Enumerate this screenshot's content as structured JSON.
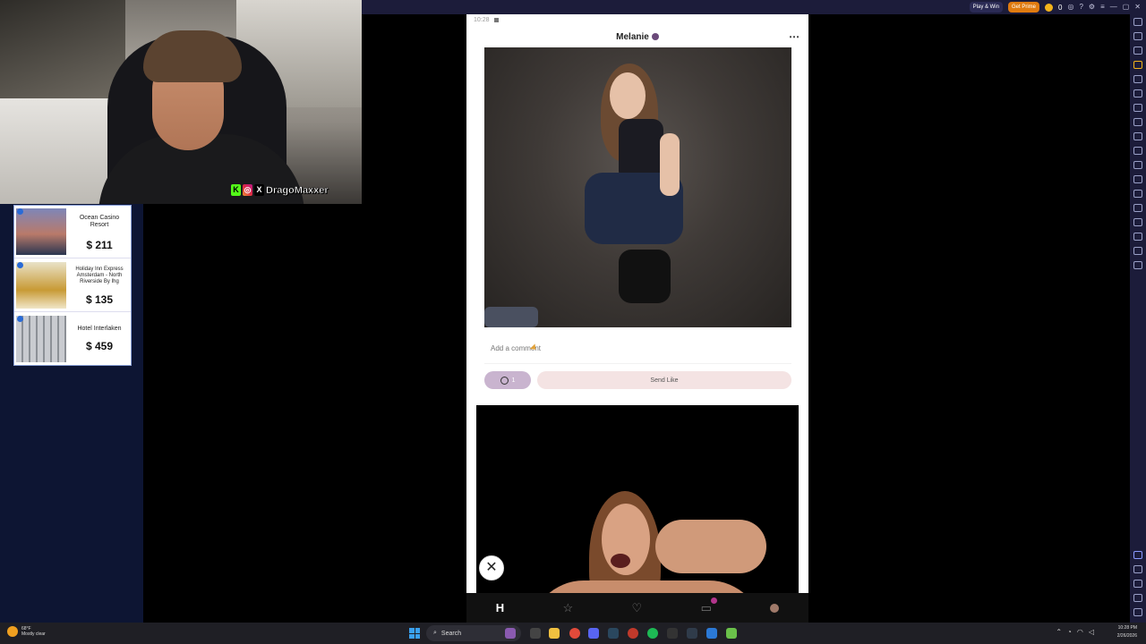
{
  "emulator": {
    "play_win_label": "Play & Win",
    "get_prime_label": "Get Prime",
    "coin_count": "0"
  },
  "stream": {
    "handle": "DragoMaxxer"
  },
  "ad": {
    "items": [
      {
        "name": "Ocean Casino Resort",
        "price": "$ 211"
      },
      {
        "name": "Holiday Inn Express Amsterdam - North Riverside By Ihg",
        "price": "$ 135"
      },
      {
        "name": "Hotel Interlaken",
        "price": "$ 459"
      }
    ]
  },
  "phone": {
    "status_time": "10:28",
    "profile_name": "Melanie",
    "comment_placeholder": "Add a comment",
    "rose_count": "1",
    "send_like_label": "Send Like",
    "close_glyph": "✕"
  },
  "taskbar": {
    "weather_temp": "68°F",
    "weather_desc": "Mostly clear",
    "search_label": "Search",
    "time": "10:28 PM",
    "date": "2/26/2026"
  },
  "colors": {
    "accent": "#c9b4cf",
    "send_like_bg": "#f4e3e3",
    "emulator_bar": "#1c1c3a",
    "prime": "#e07b10"
  }
}
